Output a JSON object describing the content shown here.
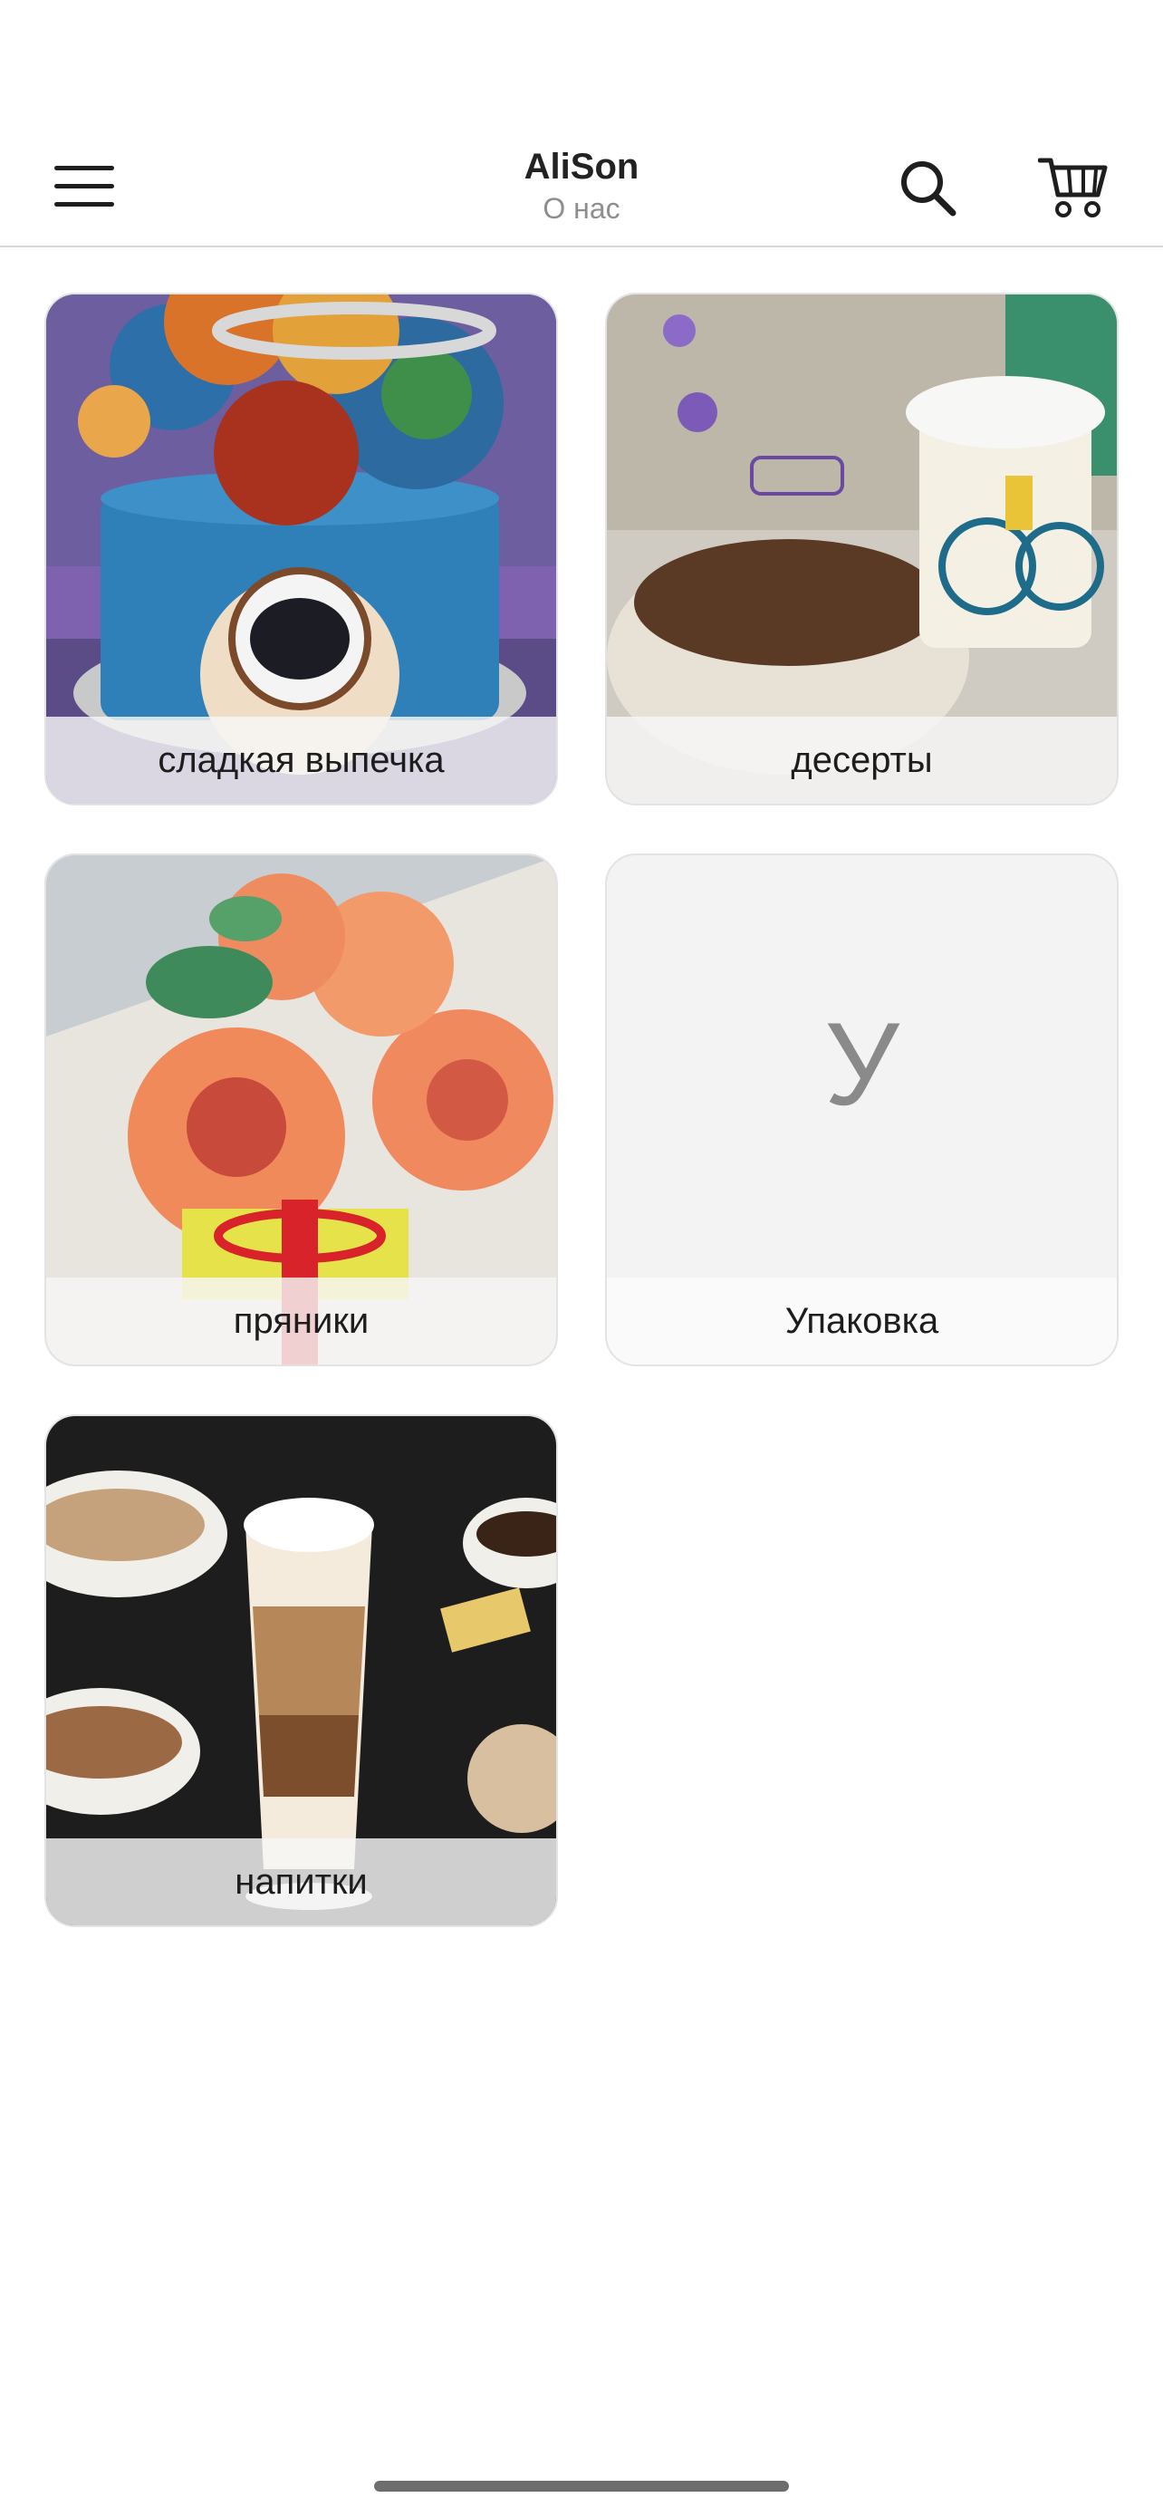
{
  "header": {
    "title": "AliSon",
    "subtitle": "О нас",
    "menu_icon": "hamburger-menu-icon",
    "search_icon": "search-icon",
    "cart_icon": "shopping-cart-icon"
  },
  "categories": [
    {
      "label": "сладкая выпечка",
      "image": "space-themed cake with astronaut"
    },
    {
      "label": "десерты",
      "image": "tiramisu dessert with coffee cup"
    },
    {
      "label": "пряники",
      "image": "flower gingerbread cookies bouquet"
    },
    {
      "label": "Упаковка",
      "placeholder_letter": "У"
    },
    {
      "label": "напитки",
      "image": "caffe latte chalkboard illustration"
    }
  ],
  "colors": {
    "text": "#222222",
    "subtitle": "#8e8e8e",
    "divider": "#dadada"
  }
}
